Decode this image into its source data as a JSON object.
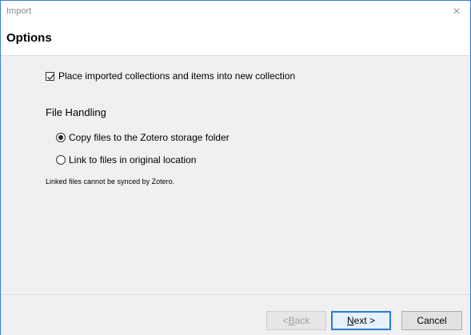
{
  "window": {
    "title": "Import",
    "close_glyph": "×"
  },
  "header": {
    "title": "Options"
  },
  "options": {
    "new_collection_label": "Place imported collections and items into new collection",
    "new_collection_checked": true,
    "file_handling_label": "File Handling",
    "radio_copy_label": "Copy files to the Zotero storage folder",
    "radio_link_label": "Link to files in original location",
    "selected_radio": "copy",
    "note": "Linked files cannot be synced by Zotero."
  },
  "footer": {
    "back_prefix": "< ",
    "back_mnemonic": "B",
    "back_rest": "ack",
    "next_mnemonic": "N",
    "next_rest": "ext >",
    "cancel_label": "Cancel"
  },
  "colors": {
    "accent": "#2a7ad6",
    "window_border": "#3a7bd5",
    "background": "#f0f0f0"
  }
}
